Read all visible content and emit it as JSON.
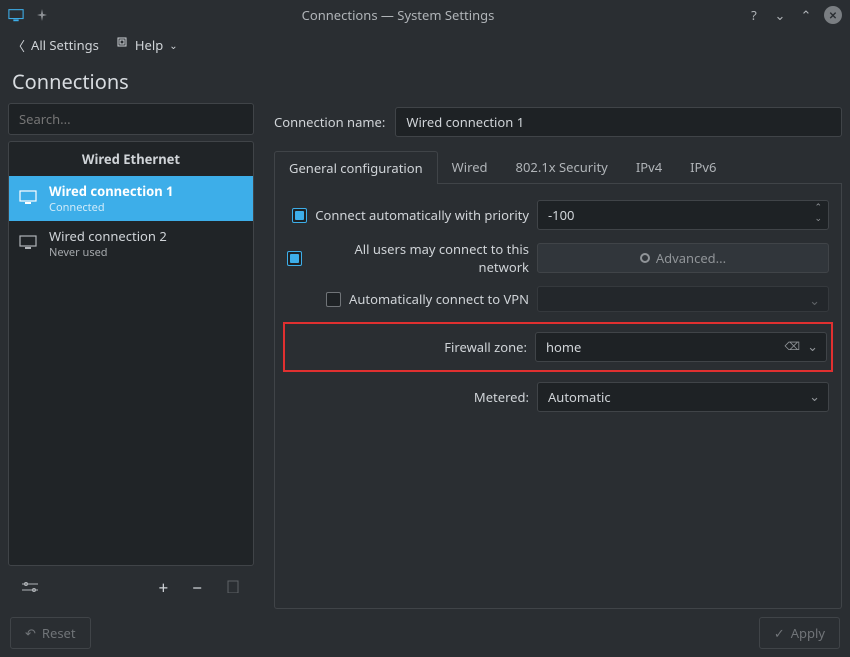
{
  "window": {
    "title": "Connections — System Settings"
  },
  "toolbar": {
    "back_label": "All Settings",
    "help_label": "Help"
  },
  "page": {
    "title": "Connections"
  },
  "sidebar": {
    "search_placeholder": "Search...",
    "section_header": "Wired Ethernet",
    "items": [
      {
        "name": "Wired connection 1",
        "status": "Connected",
        "selected": true
      },
      {
        "name": "Wired connection 2",
        "status": "Never used",
        "selected": false
      }
    ]
  },
  "form": {
    "connection_name_label": "Connection name:",
    "connection_name_value": "Wired connection 1",
    "tabs": [
      "General configuration",
      "Wired",
      "802.1x Security",
      "IPv4",
      "IPv6"
    ],
    "active_tab": 0,
    "auto_connect_label": "Connect automatically with priority",
    "auto_connect_checked": true,
    "priority_value": "-100",
    "all_users_label": "All users may connect to this network",
    "all_users_checked": true,
    "advanced_label": "Advanced...",
    "auto_vpn_label": "Automatically connect to VPN",
    "auto_vpn_checked": false,
    "firewall_label": "Firewall zone:",
    "firewall_value": "home",
    "metered_label": "Metered:",
    "metered_value": "Automatic"
  },
  "footer": {
    "reset_label": "Reset",
    "apply_label": "Apply"
  }
}
